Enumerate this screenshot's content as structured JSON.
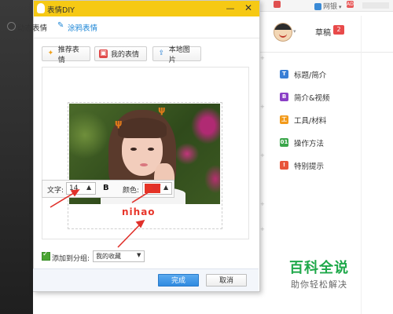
{
  "top_nav": {
    "item1": "",
    "item2": "网银",
    "item3_icon": "AD"
  },
  "user": {
    "draft_label": "草稿",
    "draft_count": "2"
  },
  "tips": [
    {
      "icon": "T",
      "label": "标题/简介",
      "color": "#3a7fd6"
    },
    {
      "icon": "B",
      "label": "简介&视频",
      "color": "#8a3fc6"
    },
    {
      "icon": "工",
      "label": "工具/材料",
      "color": "#f29a1a"
    },
    {
      "icon": "01",
      "label": "操作方法",
      "color": "#3aa64a"
    },
    {
      "icon": "!",
      "label": "特别提示",
      "color": "#e8553a"
    }
  ],
  "watermark": {
    "main": "百科全说",
    "sub": "助你轻松解决"
  },
  "dialog": {
    "title": "表情DIY",
    "tabs": {
      "animated": "动态表情",
      "doodle": "涂鸦表情"
    },
    "toolbar": {
      "recommended": "推荐表情",
      "mine": "我的表情",
      "local": "本地图片"
    },
    "text_tool": {
      "text_label": "文字:",
      "size_value": "14",
      "bold": "B",
      "color_label": "颜色:",
      "color_value": "#e53325"
    },
    "overlay_text": "nihao",
    "add_to_group_label": "添加到分组:",
    "group_value": "我的收藏",
    "buttons": {
      "done": "完成",
      "cancel": "取消"
    }
  },
  "colors": {
    "title_bar": "#f6c914",
    "accent_blue": "#1c86d6",
    "annotation_red": "#e0302a"
  }
}
